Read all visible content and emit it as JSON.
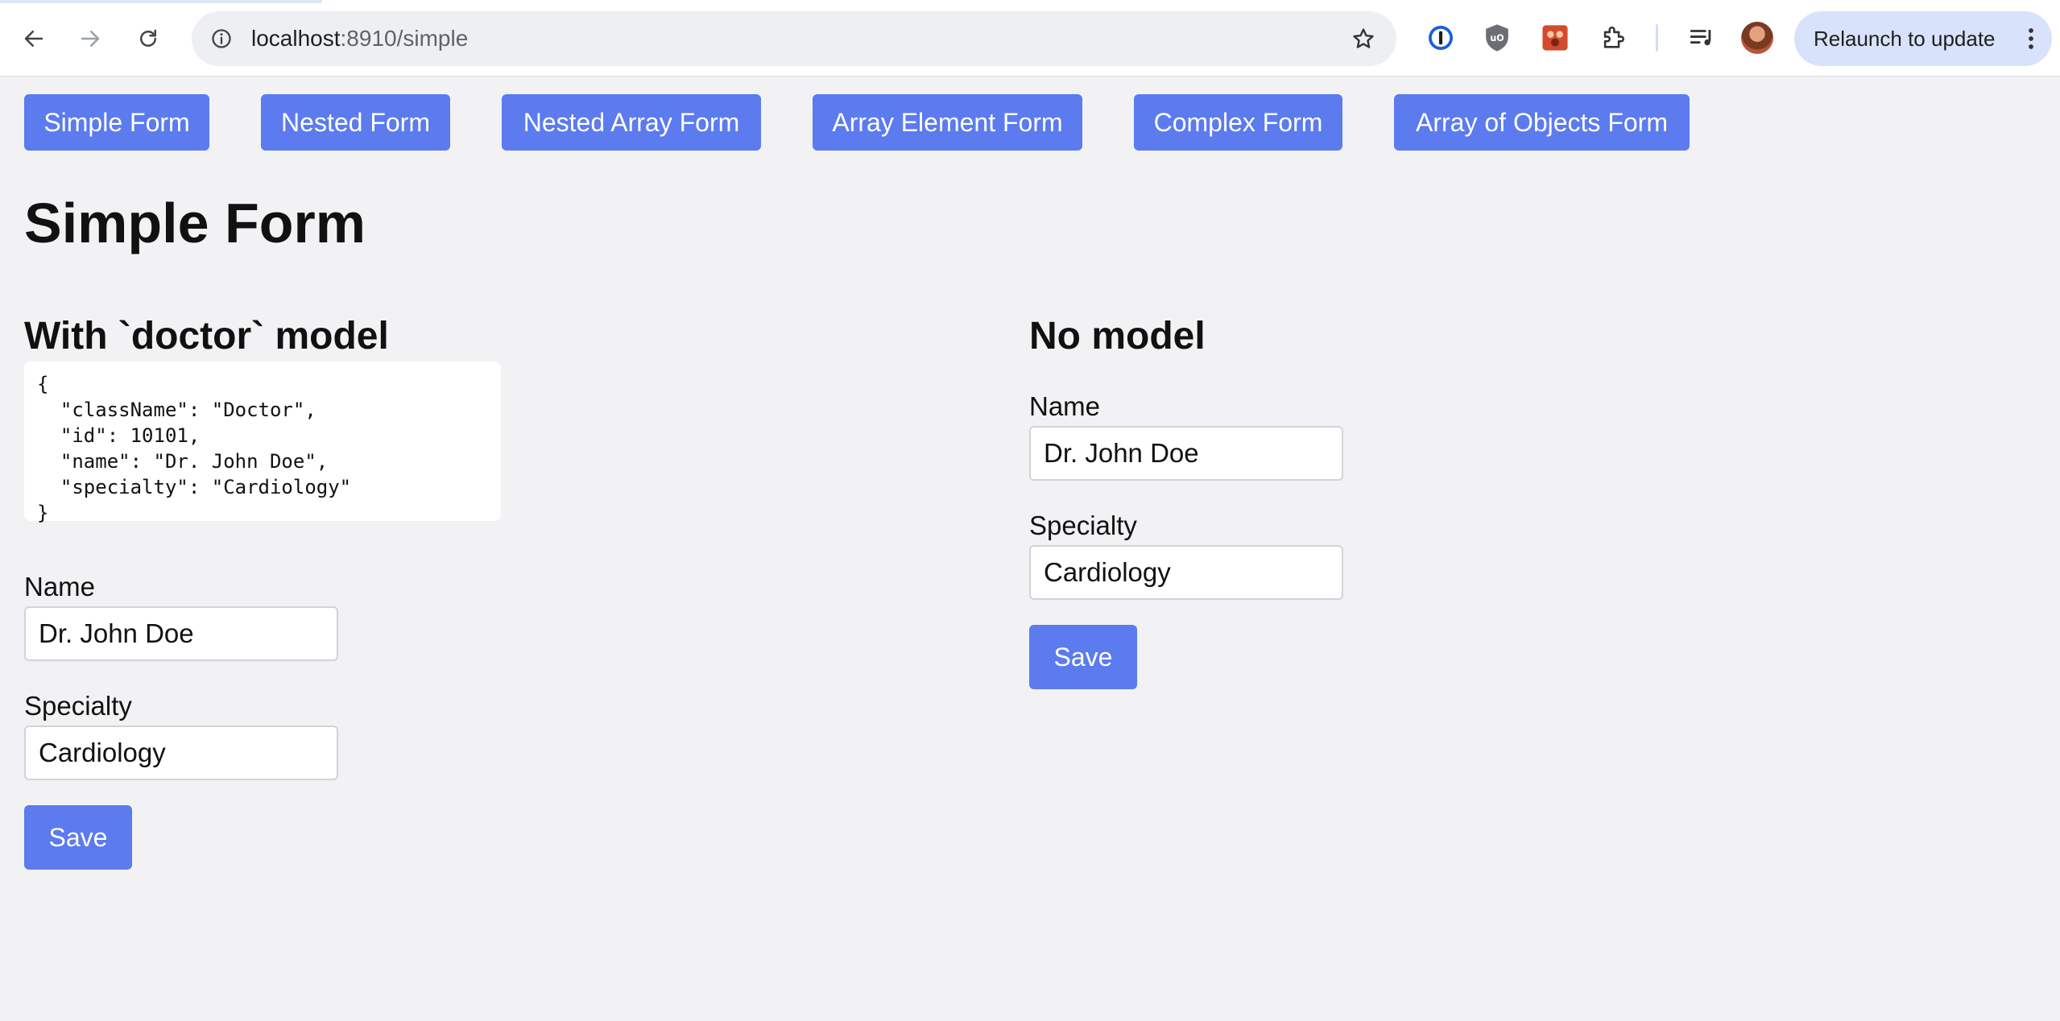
{
  "browser": {
    "url_host": "localhost",
    "url_rest": ":8910/simple",
    "relaunch_label": "Relaunch to update",
    "icons": {
      "back": "arrow-left-icon",
      "forward": "arrow-right-icon",
      "reload": "reload-icon",
      "site_info": "info-icon",
      "bookmark": "star-icon",
      "password_manager": "1password-icon",
      "ublock": "ublock-icon",
      "extension_red": "red-extension-icon",
      "extensions": "puzzle-icon",
      "media": "media-queue-icon",
      "menu": "more-vertical-icon"
    }
  },
  "nav": {
    "buttons": [
      "Simple Form",
      "Nested Form",
      "Nested Array Form",
      "Array Element Form",
      "Complex Form",
      "Array of Objects Form"
    ]
  },
  "page": {
    "title": "Simple Form"
  },
  "with_model": {
    "heading": "With `doctor` model",
    "json": "{\n  \"className\": \"Doctor\",\n  \"id\": 10101,\n  \"name\": \"Dr. John Doe\",\n  \"specialty\": \"Cardiology\"\n}",
    "name_label": "Name",
    "name_value": "Dr. John Doe",
    "specialty_label": "Specialty",
    "specialty_value": "Cardiology",
    "save_label": "Save"
  },
  "no_model": {
    "heading": "No model",
    "name_label": "Name",
    "name_value": "Dr. John Doe",
    "specialty_label": "Specialty",
    "specialty_value": "Cardiology",
    "save_label": "Save"
  },
  "colors": {
    "accent": "#5b7bef",
    "page_background": "#f2f2f5",
    "relaunch_background": "#d9e2fb"
  }
}
